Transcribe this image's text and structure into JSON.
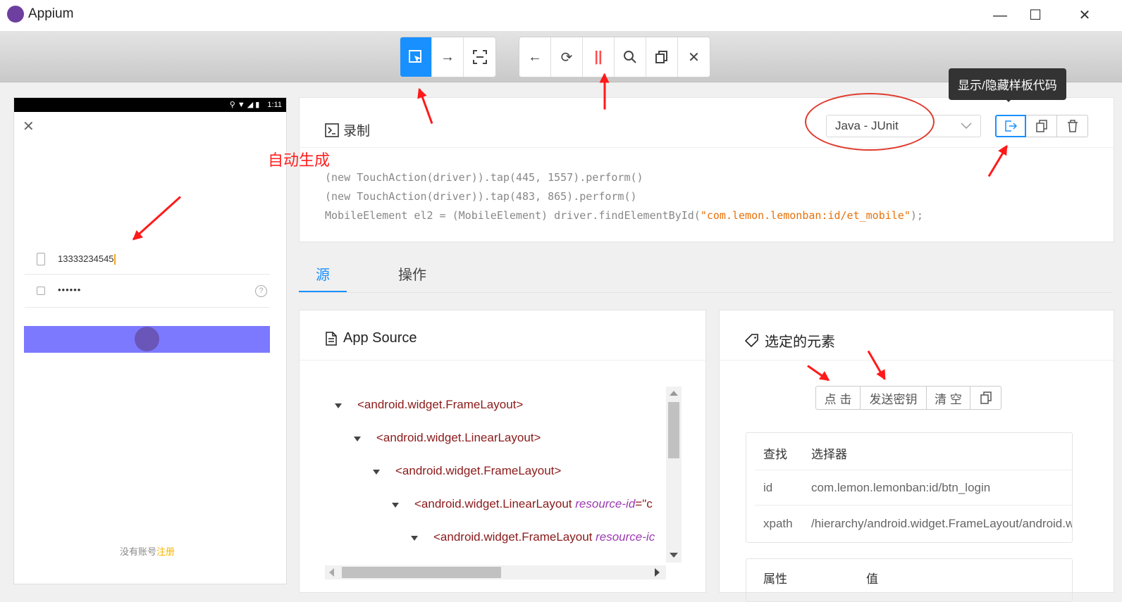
{
  "window": {
    "title": "Appium",
    "minimize_glyph": "—",
    "maximize_glyph": "☐",
    "close_glyph": "✕"
  },
  "toolbar": {
    "group1": [
      {
        "name": "select-elements-icon",
        "glyph": "⬚",
        "active": true
      },
      {
        "name": "swipe-icon",
        "glyph": "→",
        "active": false
      },
      {
        "name": "tap-by-coordinates-icon",
        "glyph": "⛶",
        "active": false
      }
    ],
    "group2": [
      {
        "name": "back-icon",
        "glyph": "←"
      },
      {
        "name": "refresh-icon",
        "glyph": "⟳"
      },
      {
        "name": "pause-icon",
        "glyph": "||"
      },
      {
        "name": "search-icon",
        "glyph": "⌕"
      },
      {
        "name": "copy-xml-icon",
        "glyph": "❐"
      },
      {
        "name": "close-session-icon",
        "glyph": "✕"
      }
    ]
  },
  "device": {
    "status_time": "1:11",
    "close_glyph": "✕",
    "phone_value": "13333234545",
    "password_value": "••••••",
    "help_glyph": "?",
    "no_account_text": "没有账号",
    "register_link": "注册"
  },
  "recorder": {
    "title": "录制",
    "language": "Java - JUnit",
    "tooltip": "显示/隐藏样板代码",
    "code_lines": [
      {
        "text": "(new TouchAction(driver)).tap(445, 1557).perform()"
      },
      {
        "text": "(new TouchAction(driver)).tap(483, 865).perform()"
      },
      {
        "pre": "MobileElement el2 = (MobileElement) driver.findElementById(",
        "str": "\"com.lemon.lemonban:id/et_mobile\"",
        "post": ");"
      }
    ]
  },
  "annotations": {
    "auto_generate": "自动生成"
  },
  "tabs": {
    "source": "源",
    "actions": "操作"
  },
  "source_panel": {
    "title": "App Source",
    "tree": [
      {
        "tag": "<android.widget.FrameLayout>",
        "attr": "",
        "rest": ""
      },
      {
        "tag": "<android.widget.LinearLayout>",
        "attr": "",
        "rest": ""
      },
      {
        "tag": "<android.widget.FrameLayout>",
        "attr": "",
        "rest": ""
      },
      {
        "tag": "<android.widget.LinearLayout ",
        "attr": "resource-id",
        "rest": "=\"c"
      },
      {
        "tag": "<android.widget.FrameLayout ",
        "attr": "resource-ic",
        "rest": ""
      }
    ]
  },
  "selected_panel": {
    "title": "选定的元素",
    "buttons": {
      "tap": "点 击",
      "send_keys": "发送密钥",
      "clear": "清 空"
    },
    "table": {
      "col_find": "查找",
      "col_selector": "选择器",
      "rows": [
        {
          "key": "id",
          "value": "com.lemon.lemonban:id/btn_login"
        },
        {
          "key": "xpath",
          "value": "/hierarchy/android.widget.FrameLayout/android.wi"
        }
      ]
    },
    "attr_table": {
      "col_attr": "属性",
      "col_value": "值"
    }
  }
}
